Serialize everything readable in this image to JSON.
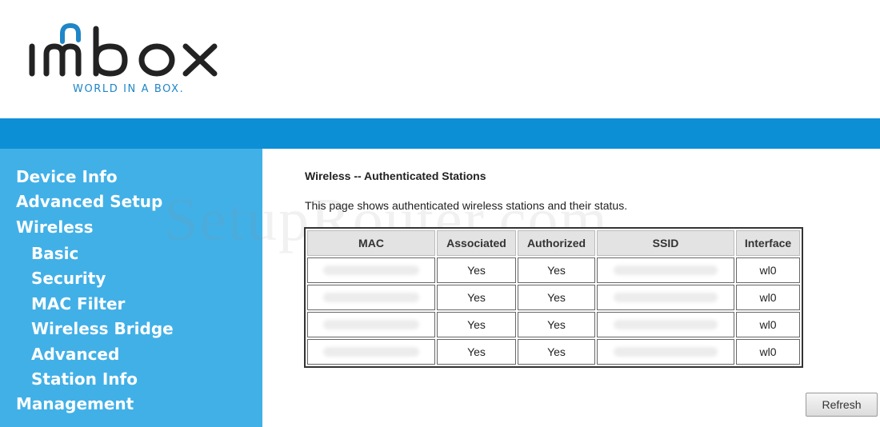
{
  "brand": {
    "logo_text": "imbox",
    "tagline": "WORLD IN A BOX."
  },
  "colors": {
    "header_bar": "#0d8fd6",
    "sidebar": "#41b0e7",
    "logo_accent": "#1f86c7",
    "logo_dark": "#222222"
  },
  "watermark": "SetupRouter.com",
  "sidebar": {
    "items": [
      {
        "label": "Device Info"
      },
      {
        "label": "Advanced Setup"
      },
      {
        "label": "Wireless"
      },
      {
        "label": "Basic"
      },
      {
        "label": "Security"
      },
      {
        "label": "MAC Filter"
      },
      {
        "label": "Wireless Bridge"
      },
      {
        "label": "Advanced"
      },
      {
        "label": "Station Info"
      },
      {
        "label": "Management"
      }
    ]
  },
  "main": {
    "title": "Wireless -- Authenticated Stations",
    "description": "This page shows authenticated wireless stations and their status.",
    "table": {
      "headers": [
        "MAC",
        "Associated",
        "Authorized",
        "SSID",
        "Interface"
      ],
      "rows": [
        {
          "associated": "Yes",
          "authorized": "Yes",
          "interface": "wl0"
        },
        {
          "associated": "Yes",
          "authorized": "Yes",
          "interface": "wl0"
        },
        {
          "associated": "Yes",
          "authorized": "Yes",
          "interface": "wl0"
        },
        {
          "associated": "Yes",
          "authorized": "Yes",
          "interface": "wl0"
        }
      ]
    },
    "refresh_label": "Refresh"
  }
}
